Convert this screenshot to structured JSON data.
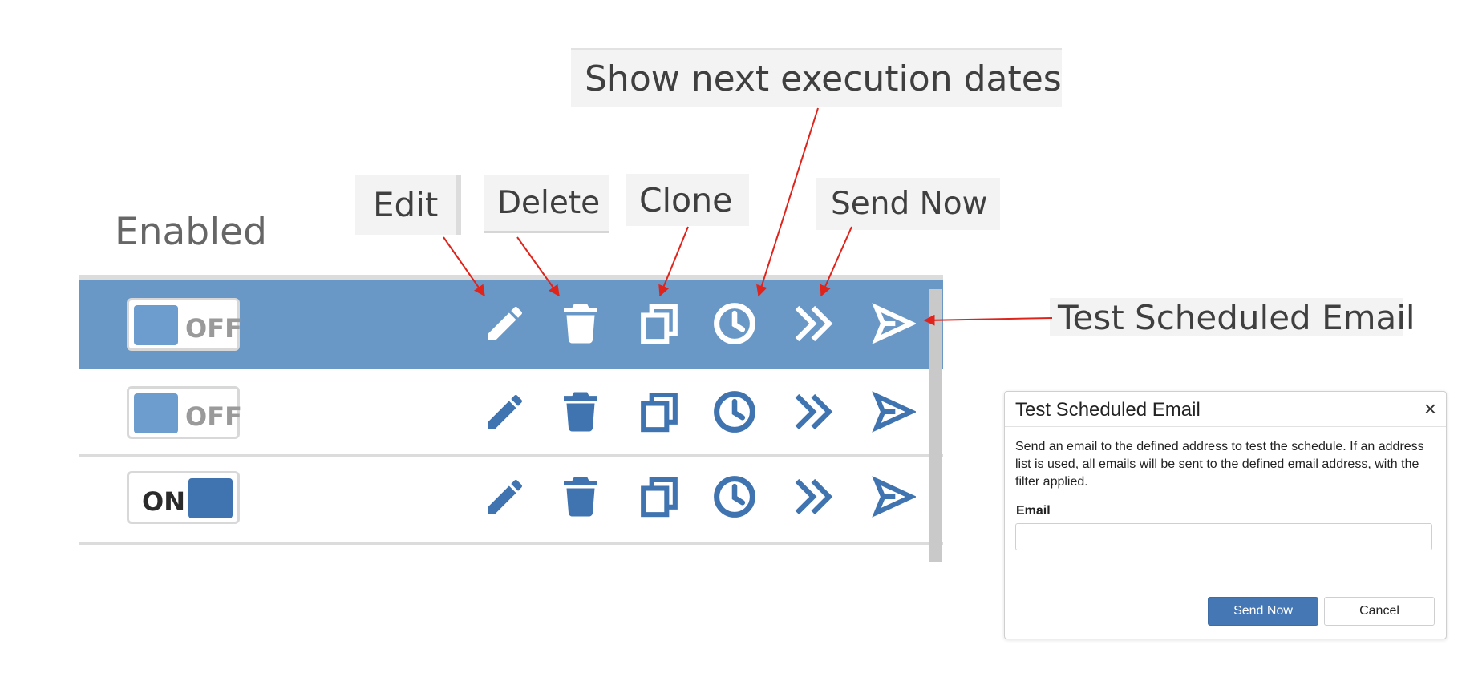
{
  "callouts": {
    "edit": "Edit",
    "delete": "Delete",
    "clone": "Clone",
    "next_dates": "Show next execution dates",
    "send_now": "Send Now",
    "test_email": "Test Scheduled Email"
  },
  "table": {
    "header_enabled": "Enabled",
    "rows": [
      {
        "toggle": "OFF",
        "selected": true
      },
      {
        "toggle": "OFF",
        "selected": false
      },
      {
        "toggle": "ON",
        "selected": false
      }
    ],
    "action_icons": [
      "pencil-icon",
      "trash-icon",
      "clone-icon",
      "clock-icon",
      "double-chevron-right-icon",
      "send-icon"
    ]
  },
  "dialog": {
    "title": "Test Scheduled Email",
    "close_glyph": "×",
    "body": "Send an email to the defined address to test the schedule. If an address list is used, all emails will be sent to the defined email address, with the filter applied.",
    "email_label": "Email",
    "email_value": "",
    "send_label": "Send Now",
    "cancel_label": "Cancel"
  },
  "colors": {
    "selected_row": "#6a98c6",
    "icon_blue": "#3f74b1",
    "primary_button": "#4577b5",
    "arrow_red": "#e0231b"
  }
}
